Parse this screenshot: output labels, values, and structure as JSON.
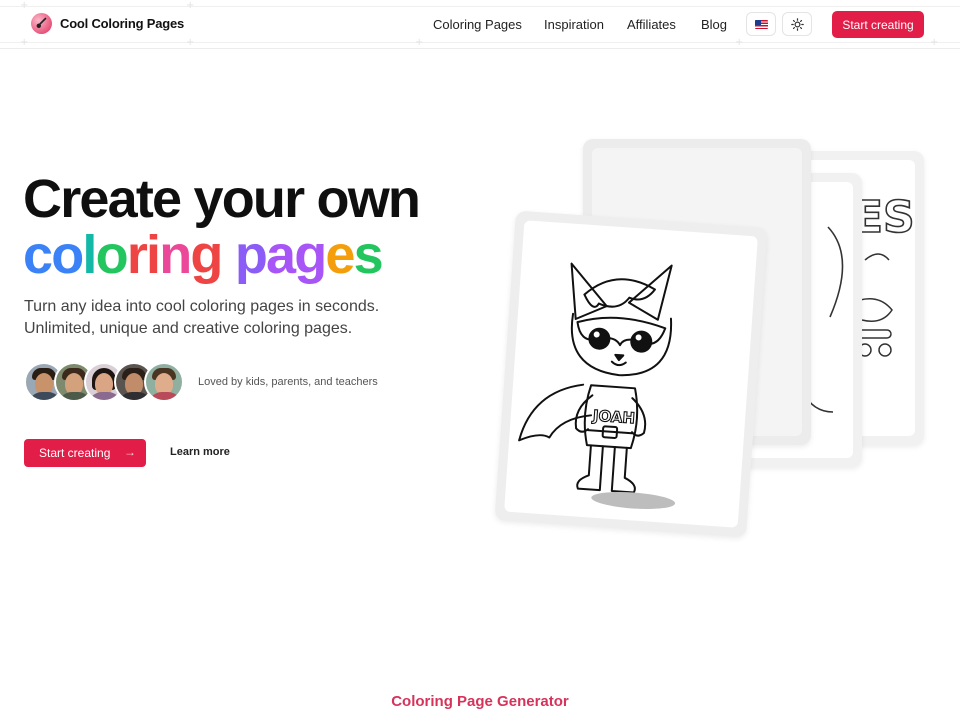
{
  "header": {
    "brand": "Cool Coloring Pages",
    "nav": [
      "Coloring Pages",
      "Inspiration",
      "Affiliates",
      "Blog"
    ],
    "language_icon": "us-flag-icon",
    "theme_icon": "sun-icon",
    "cta": "Start creating"
  },
  "hero": {
    "headline_line1": "Create your own",
    "headline_line2_words": [
      {
        "text": "coloring",
        "letters": [
          "c",
          "o",
          "l",
          "o",
          "r",
          "i",
          "n",
          "g"
        ],
        "colors": [
          "#3b82f6",
          "#3b82f6",
          "#14b8a6",
          "#22c55e",
          "#ef4444",
          "#ef4444",
          "#ec4899",
          "#ef4444"
        ]
      },
      {
        "text": "pages",
        "letters": [
          "p",
          "a",
          "g",
          "e",
          "s"
        ],
        "colors": [
          "#8b5cf6",
          "#a855f7",
          "#a855f7",
          "#f59e0b",
          "#22c55e"
        ]
      }
    ],
    "subtitle_line1": "Turn any idea into cool coloring pages in seconds.",
    "subtitle_line2": "Unlimited, unique and creative coloring pages.",
    "social_proof": "Loved by kids, parents, and teachers",
    "cta_primary": "Start creating",
    "cta_arrow": "→",
    "cta_secondary": "Learn more"
  },
  "illustration": {
    "main_card_text": "JOAH",
    "back_card_text": "ES"
  },
  "section_label": "Coloring Page Generator",
  "colors": {
    "accent": "#e11d48",
    "section_label": "#d6335a"
  }
}
